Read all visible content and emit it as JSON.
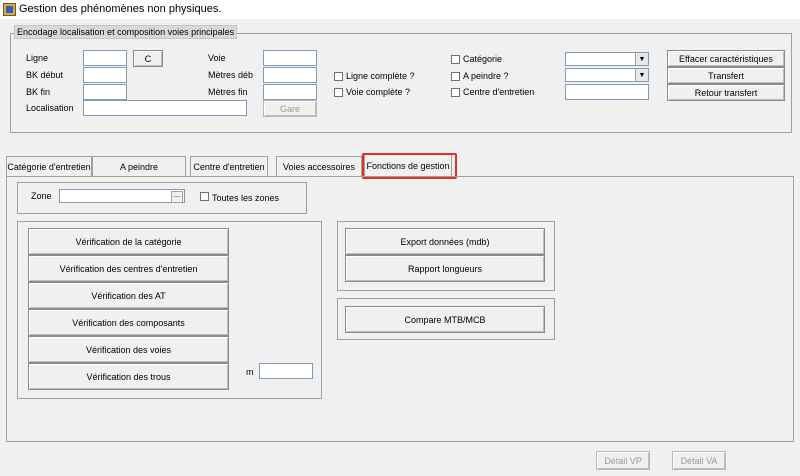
{
  "window": {
    "title": "Gestion des phénomènes non physiques."
  },
  "encoding": {
    "legend": "Encodage localisation et composition voies principales",
    "ligne_label": "Ligne",
    "ligne_btn": "C",
    "bk_debut_label": "BK début",
    "bk_fin_label": "BK fin",
    "localisation_label": "Localisation",
    "voie_label": "Voie",
    "metres_deb_label": "Mètres déb",
    "metres_fin_label": "Mètres fin",
    "gare_button": "Gare",
    "ligne_complete": "Ligne complète ?",
    "voie_complete": "Voie complète ?",
    "categorie": "Catégorie",
    "a_peindre": "A peindre ?",
    "centre_entretien": "Centre d'entretien",
    "effacer_button": "Effacer caractéristiques",
    "transfert_button": "Transfert",
    "retour_button": "Retour transfert"
  },
  "tabs": [
    {
      "label": "Catégorie d'entretien"
    },
    {
      "label": "A peindre"
    },
    {
      "label": "Centre d'entretien"
    },
    {
      "label": "Voies accessoires"
    },
    {
      "label": "Fonctions de gestion"
    }
  ],
  "gestion": {
    "zone_label": "Zone",
    "zone_browse": "...",
    "toutes_zones": "Toutes les zones",
    "verification_buttons": [
      "Vérification de la catégorie",
      "Vérification des centres d'entretien",
      "Vérification des AT",
      "Vérification des composants",
      "Vérification des voies",
      "Vérification des trous"
    ],
    "m_label": "m",
    "export_button": "Export données (mdb)",
    "rapport_button": "Rapport longueurs",
    "compare_button": "Compare MTB/MCB"
  },
  "footer": {
    "detail_vp": "Détail VP",
    "detail_va": "Détail VA"
  }
}
